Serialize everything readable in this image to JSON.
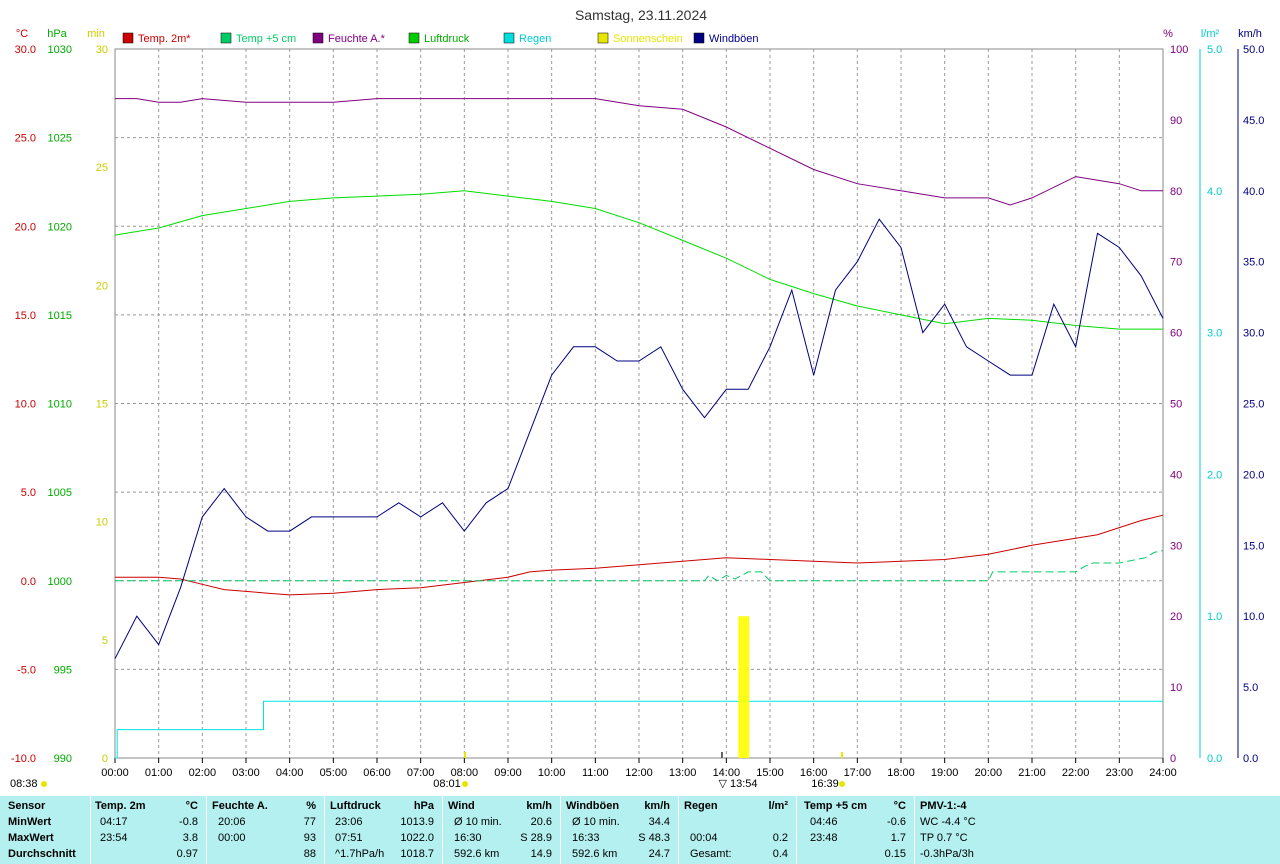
{
  "title": "Samstag, 23.11.2024",
  "colors": {
    "temp2m": "#cc0000",
    "temp5cm": "#00cc66",
    "humidity": "#800080",
    "pressure": "#00dd00",
    "rain": "#00e5e5",
    "sunshine": "#ffff00",
    "gusts": "#000080"
  },
  "legend": [
    {
      "label": "Temp. 2m*",
      "color": "#cc0000"
    },
    {
      "label": "Temp +5 cm",
      "color": "#00cc66"
    },
    {
      "label": "Feuchte A.*",
      "color": "#800080"
    },
    {
      "label": "Luftdruck",
      "color": "#00cc00"
    },
    {
      "label": "Regen",
      "color": "#00dddd"
    },
    {
      "label": "Sonnenschein",
      "color": "#e6e600"
    },
    {
      "label": "Windböen",
      "color": "#000080"
    }
  ],
  "chart_data": {
    "type": "line",
    "x_range": [
      "00:00",
      "24:00"
    ],
    "x_ticks": [
      "00:00",
      "01:00",
      "02:00",
      "03:00",
      "04:00",
      "05:00",
      "06:00",
      "07:00",
      "08:00",
      "09:00",
      "10:00",
      "11:00",
      "12:00",
      "13:00",
      "14:00",
      "15:00",
      "16:00",
      "17:00",
      "18:00",
      "19:00",
      "20:00",
      "21:00",
      "22:00",
      "23:00",
      "24:00"
    ],
    "axes": {
      "temp_c": {
        "unit": "°C",
        "range": [
          -10,
          30
        ],
        "ticks": [
          "30.0",
          "25.0",
          "20.0",
          "15.0",
          "10.0",
          "5.0",
          "0.0",
          "-5.0",
          "-10.0"
        ]
      },
      "pressure_hpa": {
        "unit": "hPa",
        "range": [
          990,
          1030
        ],
        "ticks": [
          "1030",
          "1025",
          "1020",
          "1015",
          "1010",
          "1005",
          "1000",
          "995",
          "990"
        ]
      },
      "sunshine_min": {
        "unit": "min",
        "range": [
          0,
          30
        ],
        "ticks": [
          "30",
          "25",
          "20",
          "15",
          "10",
          "5",
          "0"
        ]
      },
      "humidity_pct": {
        "unit": "%",
        "range": [
          0,
          100
        ],
        "ticks": [
          "100",
          "90",
          "80",
          "70",
          "60",
          "50",
          "40",
          "30",
          "20",
          "10",
          "0"
        ]
      },
      "rain_lm2": {
        "unit": "l/m²",
        "range": [
          0,
          5
        ],
        "ticks": [
          "5.0",
          "4.0",
          "3.0",
          "2.0",
          "1.0",
          "0.0"
        ]
      },
      "gust_kmh": {
        "unit": "km/h",
        "range": [
          0,
          50
        ],
        "ticks": [
          "50.0",
          "45.0",
          "40.0",
          "35.0",
          "30.0",
          "25.0",
          "20.0",
          "15.0",
          "10.0",
          "5.0",
          "0.0"
        ]
      }
    },
    "grid": true,
    "markers": {
      "sunrise": "08:01",
      "sunset": "16:39",
      "noon": "13:54",
      "moonrise": "08:38"
    },
    "series": [
      {
        "name": "Temp. 2m*",
        "axis": "temp_c",
        "x": [
          0,
          1,
          1.5,
          2,
          2.5,
          3,
          3.5,
          4,
          5,
          6,
          7,
          8,
          9,
          9.5,
          10,
          11,
          12,
          13,
          14,
          15,
          16,
          17,
          18,
          19,
          20,
          21,
          22,
          22.5,
          23,
          23.5,
          24
        ],
        "y": [
          0.2,
          0.2,
          0.1,
          -0.2,
          -0.5,
          -0.6,
          -0.7,
          -0.8,
          -0.7,
          -0.5,
          -0.4,
          -0.1,
          0.2,
          0.5,
          0.6,
          0.7,
          0.9,
          1.1,
          1.3,
          1.2,
          1.1,
          1.0,
          1.1,
          1.2,
          1.5,
          2.0,
          2.4,
          2.6,
          3.0,
          3.4,
          3.7
        ]
      },
      {
        "name": "Temp +5 cm",
        "axis": "temp_c",
        "x": [
          0,
          12,
          13.5,
          13.6,
          13.8,
          14,
          14.2,
          14.5,
          14.8,
          15,
          19,
          20,
          20.1,
          22,
          22.2,
          22.4,
          23,
          23.6,
          23.8,
          24
        ],
        "y": [
          0,
          0,
          0,
          0.3,
          0,
          0.3,
          0.1,
          0.5,
          0.5,
          0,
          0,
          0,
          0.5,
          0.5,
          0.8,
          1.0,
          1.0,
          1.3,
          1.6,
          1.7
        ]
      },
      {
        "name": "Feuchte A.*",
        "axis": "humidity_pct",
        "x": [
          0,
          0.5,
          1,
          1.5,
          2,
          3,
          4,
          5,
          6,
          7,
          8,
          9,
          10,
          11,
          12,
          13,
          14,
          15,
          16,
          17,
          18,
          19,
          20,
          20.5,
          21,
          22,
          23,
          23.5,
          24
        ],
        "y": [
          93,
          93,
          92.5,
          92.5,
          93,
          92.5,
          92.5,
          92.5,
          93,
          93,
          93,
          93,
          93,
          93,
          92,
          91.5,
          89,
          86,
          83,
          81,
          80,
          79,
          79,
          78,
          79,
          82,
          81,
          80,
          80
        ]
      },
      {
        "name": "Luftdruck",
        "axis": "pressure_hpa",
        "x": [
          0,
          1,
          2,
          3,
          4,
          5,
          6,
          7,
          8,
          9,
          10,
          11,
          12,
          13,
          14,
          15,
          16,
          17,
          18,
          19,
          20,
          21,
          22,
          23,
          24
        ],
        "y": [
          1019.5,
          1019.9,
          1020.6,
          1021.0,
          1021.4,
          1021.6,
          1021.7,
          1021.8,
          1022.0,
          1021.7,
          1021.4,
          1021.0,
          1020.2,
          1019.2,
          1018.2,
          1017.0,
          1016.2,
          1015.5,
          1015.0,
          1014.5,
          1014.8,
          1014.7,
          1014.4,
          1014.2,
          1014.2
        ]
      },
      {
        "name": "Regen",
        "axis": "rain_lm2",
        "x": [
          0,
          0.05,
          0.05,
          3.4,
          3.4,
          24
        ],
        "y": [
          0,
          0,
          0.2,
          0.2,
          0.4,
          0.4
        ]
      },
      {
        "name": "Sonnenschein",
        "axis": "sunshine_min",
        "x": [
          14.3,
          14.35,
          14.4,
          14.45,
          14.5
        ],
        "y": [
          6,
          6,
          6,
          6,
          6
        ]
      },
      {
        "name": "Windböen",
        "axis": "gust_kmh",
        "x": [
          0,
          0.5,
          1,
          1.5,
          2,
          2.5,
          3,
          3.5,
          4,
          4.5,
          5,
          5.5,
          6,
          6.5,
          7,
          7.5,
          8,
          8.5,
          9,
          9.5,
          10,
          10.5,
          11,
          11.5,
          12,
          12.5,
          13,
          13.5,
          14,
          14.5,
          15,
          15.5,
          16,
          16.5,
          17,
          17.5,
          18,
          18.5,
          19,
          19.5,
          20,
          20.5,
          21,
          21.5,
          22,
          22.5,
          23,
          23.5,
          24
        ],
        "y": [
          7,
          10,
          8,
          12,
          17,
          19,
          17,
          16,
          16,
          17,
          17,
          17,
          17,
          18,
          17,
          18,
          16,
          18,
          19,
          23,
          27,
          29,
          29,
          28,
          28,
          29,
          26,
          24,
          26,
          26,
          29,
          33,
          27,
          33,
          35,
          38,
          36,
          30,
          32,
          29,
          28,
          27,
          27,
          32,
          29,
          37,
          36,
          34,
          31
        ]
      }
    ]
  },
  "stats": {
    "headers": {
      "sensor": "Sensor",
      "temp2m": "Temp. 2m",
      "temp2m_unit": "°C",
      "humidity": "Feuchte A.",
      "humidity_unit": "%",
      "pressure": "Luftdruck",
      "pressure_unit": "hPa",
      "wind": "Wind",
      "wind_unit": "km/h",
      "gusts": "Windböen",
      "gusts_unit": "km/h",
      "rain": "Regen",
      "rain_unit": "l/m²",
      "temp5cm": "Temp +5 cm",
      "temp5cm_unit": "°C",
      "pmv": "PMV-1:-4"
    },
    "rows": {
      "min": {
        "label": "MinWert",
        "t2_time": "04:17",
        "t2": "-0.8",
        "h_time": "20:06",
        "h": "77",
        "p_time": "23:06",
        "p": "1013.9",
        "w_label": "Ø 10 min.",
        "w": "20.6",
        "g_label": "Ø 10 min.",
        "g": "34.4",
        "r_time": "",
        "r": "",
        "t5_time": "04:46",
        "t5": "-0.6",
        "pmv": "WC -4.4 °C"
      },
      "max": {
        "label": "MaxWert",
        "t2_time": "23:54",
        "t2": "3.8",
        "h_time": "00:00",
        "h": "93",
        "p_time": "07:51",
        "p": "1022.0",
        "w_label": "16:30",
        "w": "S 28.9",
        "g_label": "16:33",
        "g": "S 48.3",
        "r_time": "00:04",
        "r": "0.2",
        "t5_time": "23:48",
        "t5": "1.7",
        "pmv": "TP 0.7 °C"
      },
      "avg": {
        "label": "Durchschnitt",
        "t2_time": "",
        "t2": "0.97",
        "h_time": "",
        "h": "88",
        "p_time": "^1.7hPa/h",
        "p": "1018.7",
        "w_label": "592.6 km",
        "w": "14.9",
        "g_label": "592.6 km",
        "g": "24.7",
        "r_time": "Gesamt:",
        "r": "0.4",
        "t5_time": "",
        "t5": "0.15",
        "pmv": "-0.3hPa/3h"
      }
    }
  }
}
